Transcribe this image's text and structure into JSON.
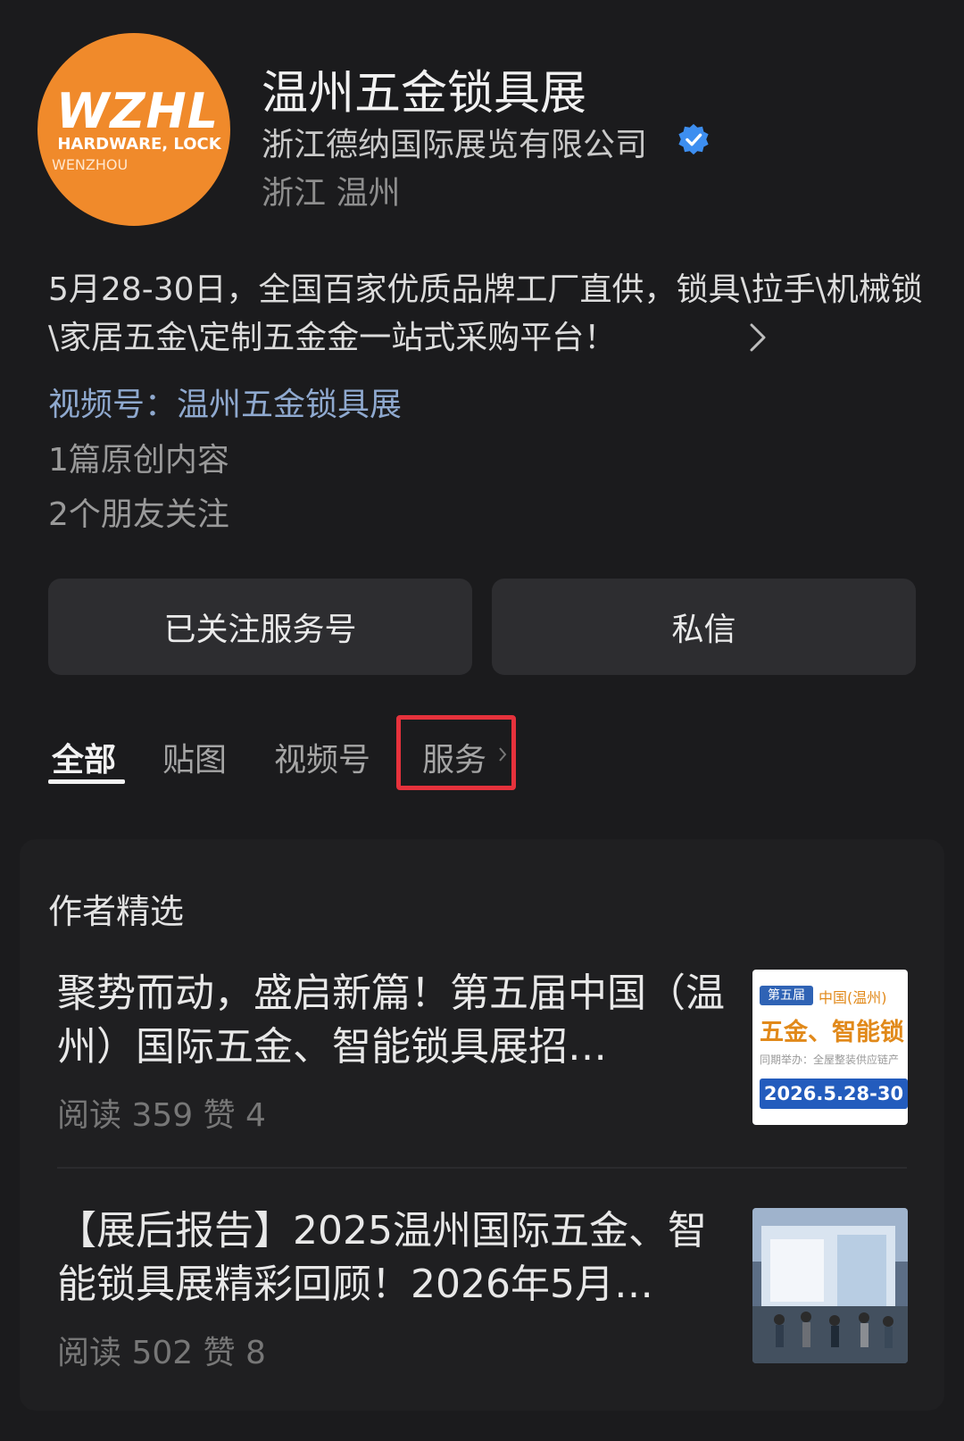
{
  "profile": {
    "logo": {
      "line1": "WZHL",
      "line2": "HARDWARE, LOCK",
      "line3": "WENZHOU",
      "color": "#f08a2b"
    },
    "title": "温州五金锁具展",
    "company": "浙江德纳国际展览有限公司",
    "verified_icon": "verified-badge-icon",
    "location": "浙江 温州"
  },
  "description": {
    "text": "5月28-30日，全国百家优质品牌工厂直供，锁具\\拉手\\机械锁\\家居五金\\定制五金金一站式采购平台！",
    "channel": "视频号：温州五金锁具展",
    "original_count": "1篇原创内容",
    "friends_following": "2个朋友关注"
  },
  "buttons": {
    "follow_label": "已关注服务号",
    "message_label": "私信"
  },
  "tabs": {
    "all": "全部",
    "images": "贴图",
    "video": "视频号",
    "service": "服务",
    "highlight_color": "#e6323c"
  },
  "picks": {
    "title": "作者精选",
    "articles": [
      {
        "title": "聚势而动，盛启新篇！第五届中国（温州）国际五金、智能锁具展招…",
        "meta": "阅读 359   赞 4",
        "thumb": {
          "badge": "第五届",
          "top": "中国(温州)",
          "big": "五金、智能锁",
          "small": "同期举办：全屋整装供应链产",
          "date": "2026.5.28-30"
        }
      },
      {
        "title": "【展后报告】2025温州国际五金、智能锁具展精彩回顾！2026年5月…",
        "meta": "阅读 502   赞 8"
      }
    ]
  }
}
